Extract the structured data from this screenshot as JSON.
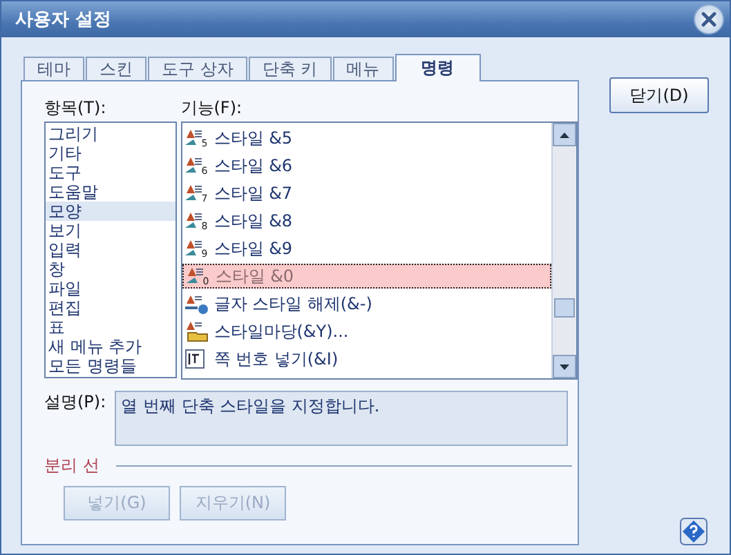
{
  "window": {
    "title": "사용자 설정"
  },
  "tabs": [
    {
      "label": "테마",
      "selected": false
    },
    {
      "label": "스킨",
      "selected": false
    },
    {
      "label": "도구 상자",
      "selected": false
    },
    {
      "label": "단축 키",
      "selected": false
    },
    {
      "label": "메뉴",
      "selected": false
    },
    {
      "label": "명령",
      "selected": true
    }
  ],
  "close_button": "닫기(D)",
  "categories": {
    "label": "항목(T):",
    "items": [
      {
        "label": "그리기",
        "selected": false
      },
      {
        "label": "기타",
        "selected": false
      },
      {
        "label": "도구",
        "selected": false
      },
      {
        "label": "도움말",
        "selected": false
      },
      {
        "label": "모양",
        "selected": true
      },
      {
        "label": "보기",
        "selected": false
      },
      {
        "label": "입력",
        "selected": false
      },
      {
        "label": "창",
        "selected": false
      },
      {
        "label": "파일",
        "selected": false
      },
      {
        "label": "편집",
        "selected": false
      },
      {
        "label": "표",
        "selected": false
      },
      {
        "label": "새 메뉴 추가",
        "selected": false
      },
      {
        "label": "모든 명령들",
        "selected": false
      }
    ]
  },
  "commands": {
    "label": "기능(F):",
    "items": [
      {
        "kind": "style",
        "number": "5",
        "label": "스타일 &5",
        "selected": false
      },
      {
        "kind": "style",
        "number": "6",
        "label": "스타일 &6",
        "selected": false
      },
      {
        "kind": "style",
        "number": "7",
        "label": "스타일 &7",
        "selected": false
      },
      {
        "kind": "style",
        "number": "8",
        "label": "스타일 &8",
        "selected": false
      },
      {
        "kind": "style",
        "number": "9",
        "label": "스타일 &9",
        "selected": false
      },
      {
        "kind": "style",
        "number": "0",
        "label": "스타일 &0",
        "selected": true
      },
      {
        "kind": "clear",
        "label": "글자 스타일 해제(&-)",
        "selected": false
      },
      {
        "kind": "gallery",
        "label": "스타일마당(&Y)...",
        "selected": false
      },
      {
        "kind": "page-number",
        "label": "쪽 번호 넣기(&I)",
        "selected": false
      }
    ]
  },
  "description": {
    "label": "설명(P):",
    "value": "열 번째 단축 스타일을 지정합니다."
  },
  "separator": {
    "label": "분리 선",
    "buttons": [
      {
        "label": "넣기(G)",
        "disabled": true
      },
      {
        "label": "지우기(N)",
        "disabled": true
      }
    ]
  }
}
